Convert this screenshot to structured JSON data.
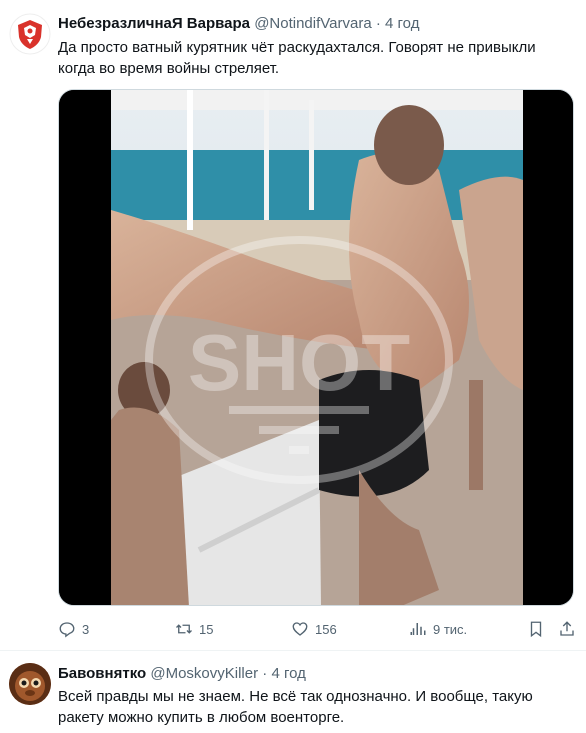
{
  "posts": [
    {
      "author_name": "НебезразличнаЯ Варвара",
      "handle": "@NotindifVarvara",
      "separator": "·",
      "time": "4 год",
      "text": "Да просто ватный курятник чёт раскудахтался. Говорят не привыкли когда во время войны стреляет.",
      "media": {
        "watermark": "SHOT"
      },
      "stats": {
        "replies": "3",
        "retweets": "15",
        "likes": "156",
        "views": "9 тис."
      }
    },
    {
      "author_name": "Бавовнятко",
      "handle": "@MoskovyKiller",
      "separator": "·",
      "time": "4 год",
      "text": "Всей правды мы не знаем. Не всё так однозначно. И вообще, такую ракету можно купить в любом военторге."
    }
  ],
  "icons": {
    "reply": "reply-icon",
    "retweet": "retweet-icon",
    "like": "heart-icon",
    "views": "views-icon",
    "bookmark": "bookmark-icon",
    "share": "share-icon"
  },
  "colors": {
    "meta": "#536471",
    "text": "#0f1419",
    "divider": "#eff3f4",
    "avatar_red": "#d9322b"
  }
}
